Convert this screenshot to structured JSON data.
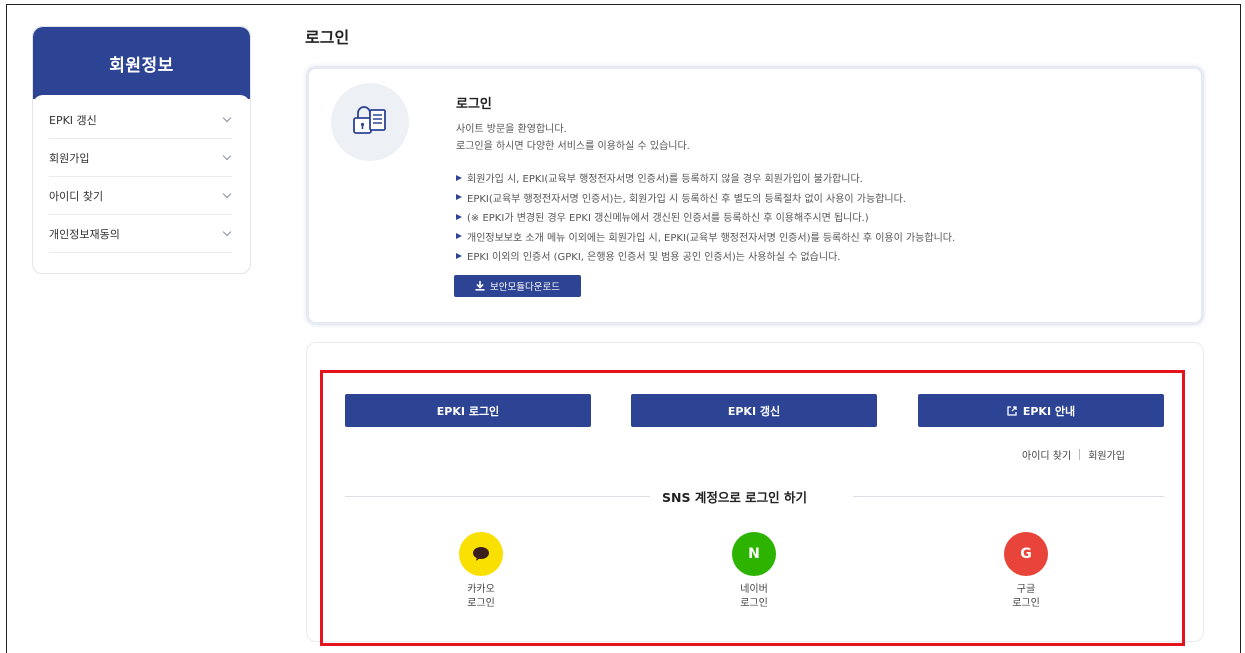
{
  "sidebar": {
    "title": "회원정보",
    "items": [
      {
        "label": "EPKI 갱신"
      },
      {
        "label": "회원가입"
      },
      {
        "label": "아이디 찾기"
      },
      {
        "label": "개인정보재동의"
      }
    ]
  },
  "page_title": "로그인",
  "info": {
    "title": "로그인",
    "desc_line1": "사이트 방문을 환영합니다.",
    "desc_line2": "로그인을 하시면 다양한 서비스를 이용하실 수 있습니다.",
    "bullets": [
      "회원가입 시, EPKI(교육부 행정전자서명 인증서)를 등록하지 않을 경우 회원가입이 불가합니다.",
      "EPKI(교육부 행정전자서명 인증서)는, 회원가입 시 등록하신 후 별도의 등록절차 없이 사용이 가능합니다.",
      "(※ EPKI가 변경된 경우 EPKI 갱신메뉴에서 갱신된 인증서를 등록하신 후 이용해주시면 됩니다.)",
      "개인정보보호 소개 메뉴 이외에는 회원가입 시, EPKI(교육부 행정전자서명 인증서)를 등록하신 후 이용이 가능합니다.",
      "EPKI 이외의 인증서 (GPKI, 은행용 인증서 및 범용 공인 인증서)는 사용하실 수 없습니다."
    ],
    "download_label": "보안모듈다운로드",
    "icon": "lock-document-icon"
  },
  "login": {
    "epki_login": "EPKI 로그인",
    "epki_renew": "EPKI 갱신",
    "epki_guide": "EPKI 안내",
    "find_id": "아이디 찾기",
    "signup": "회원가입",
    "sns_title": "SNS 계정으로 로그인 하기",
    "sns": [
      {
        "line1": "카카오",
        "line2": "로그인",
        "color": "#f9e000",
        "glyph": ""
      },
      {
        "line1": "네이버",
        "line2": "로그인",
        "color": "#2db400",
        "glyph": "N"
      },
      {
        "line1": "구글",
        "line2": "로그인",
        "color": "#e8443a",
        "glyph": "G"
      }
    ]
  },
  "colors": {
    "primary": "#2d4495",
    "highlight": "#e3141b"
  }
}
